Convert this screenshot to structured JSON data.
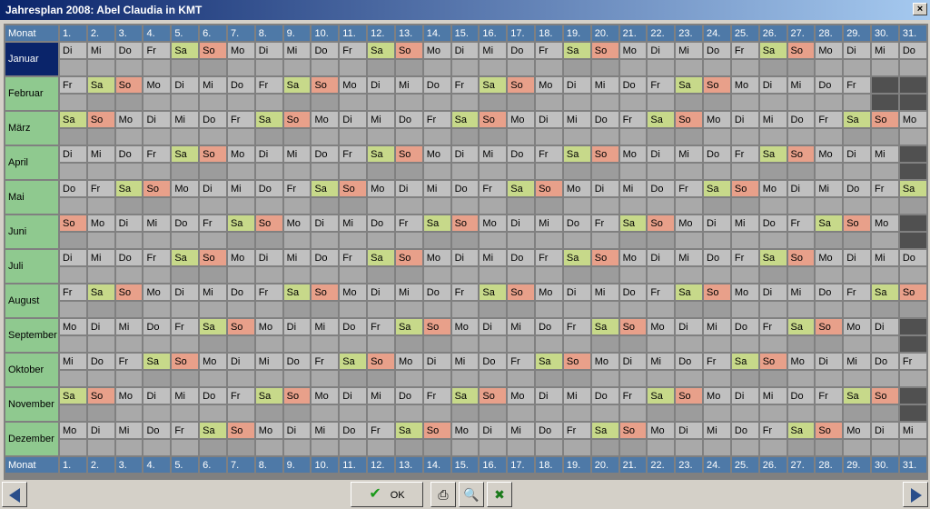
{
  "window": {
    "title": "Jahresplan 2008: Abel Claudia in KMT"
  },
  "header": {
    "monat_label": "Monat",
    "days": [
      "1.",
      "2.",
      "3.",
      "4.",
      "5.",
      "6.",
      "7.",
      "8.",
      "9.",
      "10.",
      "11.",
      "12.",
      "13.",
      "14.",
      "15.",
      "16.",
      "17.",
      "18.",
      "19.",
      "20.",
      "21.",
      "22.",
      "23.",
      "24.",
      "25.",
      "26.",
      "27.",
      "28.",
      "29.",
      "30.",
      "31."
    ]
  },
  "months": [
    {
      "name": "Januar"
    },
    {
      "name": "Februar"
    },
    {
      "name": "März"
    },
    {
      "name": "April"
    },
    {
      "name": "Mai"
    },
    {
      "name": "Juni"
    },
    {
      "name": "Juli"
    },
    {
      "name": "August"
    },
    {
      "name": "September"
    },
    {
      "name": "Oktober"
    },
    {
      "name": "November"
    },
    {
      "name": "Dezember"
    }
  ],
  "footer": {
    "ok_label": "OK",
    "print_icon": "printer-icon",
    "preview_icon": "print-preview-icon",
    "excel_icon": "excel-icon"
  }
}
